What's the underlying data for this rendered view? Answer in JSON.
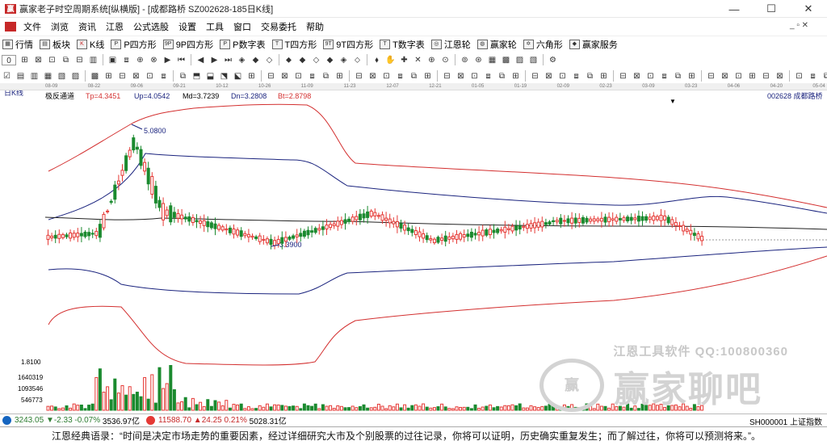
{
  "window": {
    "title": "赢家老子时空周期系统[纵横版] - [成都路桥  SZ002628-185日K线]",
    "logo_text": "赢",
    "minimize": "—",
    "maximize": "☐",
    "close": "✕"
  },
  "menu": {
    "items": [
      "文件",
      "浏览",
      "资讯",
      "江恩",
      "公式选股",
      "设置",
      "工具",
      "窗口",
      "交易委托",
      "帮助"
    ],
    "mdi_controls": "_ ▫ ✕"
  },
  "toolbar1": {
    "items": [
      {
        "icon": "▦",
        "label": "行情"
      },
      {
        "icon": "▤",
        "label": "板块"
      },
      {
        "icon": "K",
        "label": "K线"
      },
      {
        "icon": "P",
        "label": "P四方形"
      },
      {
        "icon": "9P",
        "label": "9P四方形"
      },
      {
        "icon": "P",
        "label": "P数字表"
      },
      {
        "icon": "T",
        "label": "T四方形"
      },
      {
        "icon": "9T",
        "label": "9T四方形"
      },
      {
        "icon": "T",
        "label": "T数字表"
      },
      {
        "icon": "◎",
        "label": "江恩轮"
      },
      {
        "icon": "◍",
        "label": "赢家轮"
      },
      {
        "icon": "✡",
        "label": "六角形"
      },
      {
        "icon": "◆",
        "label": "赢家服务"
      }
    ]
  },
  "toolbar2": {
    "selector_value": "0",
    "icons": [
      "⊞",
      "⊠",
      "⊡",
      "⧉",
      "⊟",
      "▥",
      "▣",
      "⧈",
      "⊕",
      "⊗",
      "▶",
      "⏮",
      "◀",
      "▶",
      "⏭",
      "◈",
      "◆",
      "◇",
      "⬥",
      "◆",
      "◇",
      "◆",
      "◈",
      "⬦",
      "⬧",
      "✋",
      "✚",
      "✕",
      "⊕",
      "⊙",
      "⊚",
      "⊛",
      "▦",
      "▩",
      "▨",
      "▧",
      "⚙"
    ]
  },
  "toolbar3": {
    "icons": [
      "☑",
      "▤",
      "▥",
      "▦",
      "▧",
      "▨",
      "▩",
      "⊞",
      "⊟",
      "⊠",
      "⊡",
      "⧈",
      "⧉",
      "⬒",
      "⬓",
      "⬔",
      "⬕",
      "⊞",
      "⊟",
      "⊠",
      "⊡",
      "⧈",
      "⧉",
      "⊞",
      "⊟",
      "⊠",
      "⊡",
      "⧈",
      "⧉",
      "⊞",
      "⊟",
      "⊠",
      "⊡",
      "⧈",
      "⧉",
      "⊞",
      "⊟",
      "⊠",
      "⊡",
      "⧈",
      "⧉",
      "⊞",
      "⊟",
      "⊠",
      "⊡",
      "⧈",
      "⧉",
      "⊞",
      "⊟",
      "⊠",
      "⊡",
      "⊞",
      "⊟",
      "⊠",
      "⊡",
      "⧈",
      "⧉",
      "⊞",
      "⊟",
      "⊠",
      "⊡",
      "⧈",
      "⧉",
      "⊞",
      "⊟",
      "⊛",
      "∞"
    ]
  },
  "time_axis": [
    "08-09",
    "08-22",
    "09-06",
    "09-21",
    "10-12",
    "10-26",
    "11-09",
    "11-23",
    "12-07",
    "12-21",
    "01-05",
    "01-19",
    "02-09",
    "02-23",
    "03-09",
    "03-23",
    "04-06",
    "04-20",
    "05-04"
  ],
  "indicator": {
    "period": "日K线",
    "name": "极反通道",
    "tp": "Tp=4.3451",
    "up": "Up=4.0542",
    "md": "Md=3.7239",
    "dn": "Dn=3.2808",
    "bt": "Bt=2.8798",
    "stock": "002628  成都路桥"
  },
  "chart_data": {
    "type": "candlestick",
    "high_label": "5.0800",
    "low_label": "3.3900",
    "volume_axis_labels": [
      "1.8100",
      "1640319",
      "1093546",
      "546773"
    ],
    "colors": {
      "up": "#e53935",
      "down": "#1b8a2f",
      "upper_band": "#d32f2f",
      "mid_band": "#1a237e",
      "center": "#222222"
    }
  },
  "watermark": {
    "line1": "江恩工具软件  QQ:100800360",
    "brand": "赢家聊吧",
    "logo": "赢"
  },
  "statusbar": {
    "sh_index": "3243.05",
    "sh_change": "▼-2.33",
    "sh_pct": "-0.07%",
    "sh_amount": "3536.97亿",
    "sz_index": "11588.70",
    "sz_change": "▲24.25",
    "sz_pct": "0.21%",
    "sz_amount": "5028.31亿",
    "right_text": "SH000001 上证指数"
  },
  "quote": "江恩经典语录：“时间是决定市场走势的重要因素，经过详细研究大市及个别股票的过往记录，你将可以证明，历史确实重复发生；而了解过往，你将可以预测将来。”。"
}
